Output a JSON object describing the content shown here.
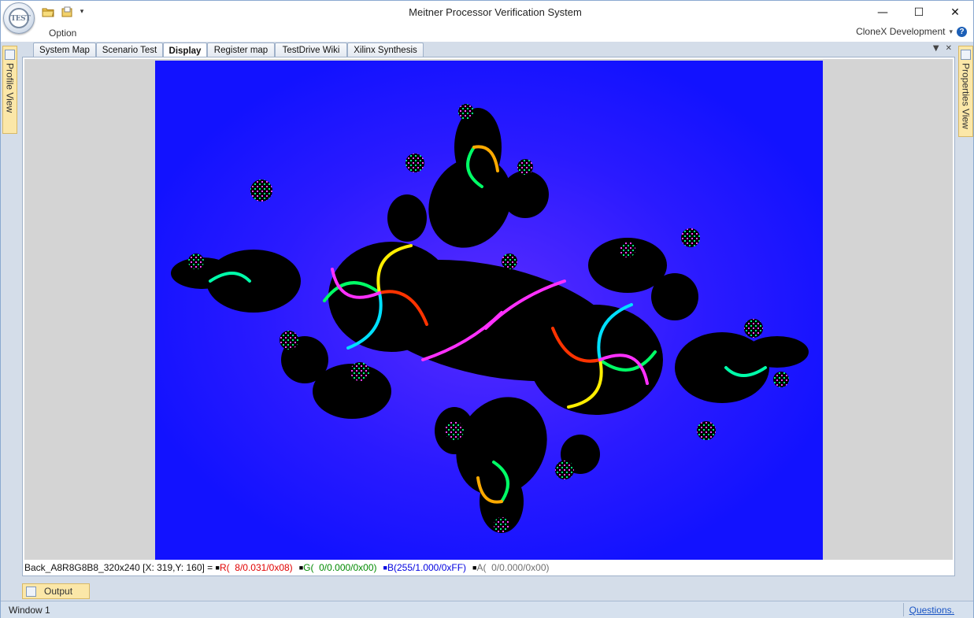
{
  "window": {
    "title": "Meitner Processor Verification System",
    "app_orb_text": "TEST",
    "quick_access": [
      "open-folder-icon",
      "new-document-icon"
    ],
    "controls": {
      "minimize": "—",
      "maximize": "☐",
      "close": "✕"
    }
  },
  "ribbon": {
    "tab": "Option",
    "profile": "CloneX Development",
    "help": "?"
  },
  "side_panels": {
    "left": "Profile View",
    "right": "Properties View"
  },
  "tabs": [
    {
      "label": "System Map",
      "active": false
    },
    {
      "label": "Scenario Test",
      "active": false
    },
    {
      "label": "Display",
      "active": true
    },
    {
      "label": "Register map",
      "active": false
    },
    {
      "label": "TestDrive Wiki",
      "active": false
    },
    {
      "label": "Xilinx Synthesis",
      "active": false
    }
  ],
  "display": {
    "image": "julia-set-fractal",
    "colors": {
      "background": "#1212ff",
      "fill": "#000000"
    }
  },
  "pixel_info": {
    "buffer": "Back_A8R8G8B8_320x240 [X: 319,Y: 160] = ",
    "r_label": "R(",
    "r_value": "  8/0.031/0x08)",
    "g_label": "G(",
    "g_value": "  0/0.000/0x00)",
    "b_label": "B(",
    "b_value": "255/1.000/0xFF)",
    "a_label": "A(",
    "a_value": "  0/0.000/0x00)",
    "colors": {
      "r": "#e00000",
      "g": "#008a00",
      "b": "#0000e0",
      "a": "#707070"
    }
  },
  "output_panel": {
    "label": "Output"
  },
  "statusbar": {
    "left": "Window 1",
    "link": "Questions."
  }
}
